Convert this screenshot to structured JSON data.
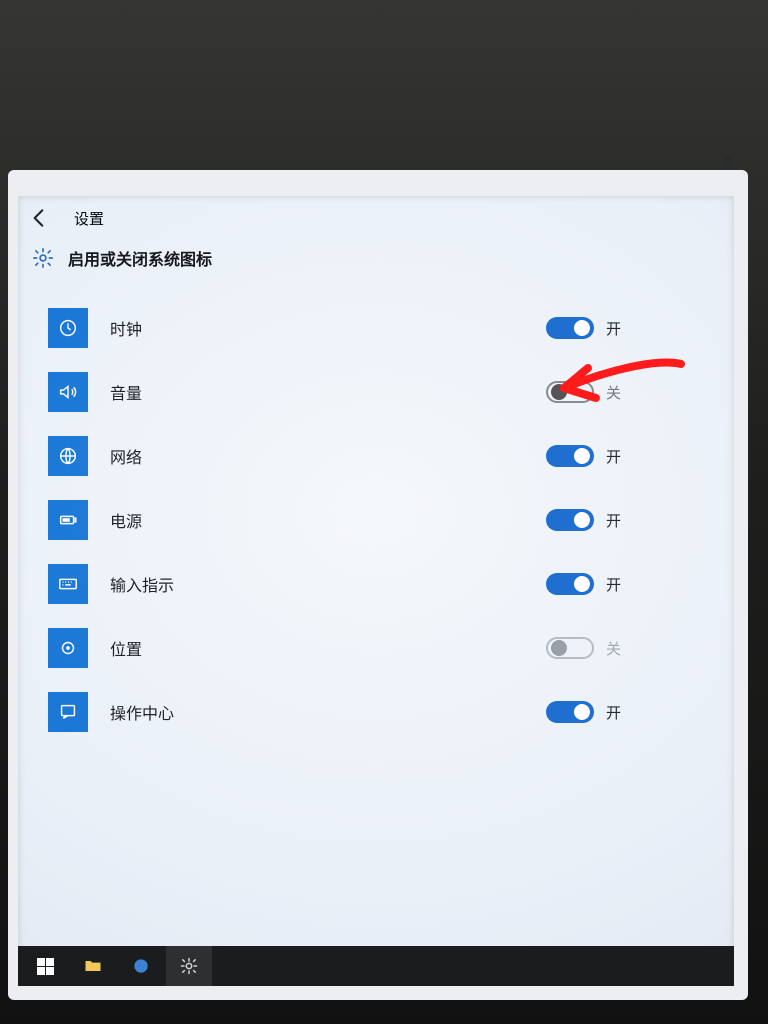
{
  "header": {
    "app_title": "设置",
    "page_title": "启用或关闭系统图标"
  },
  "states": {
    "on": "开",
    "off": "关"
  },
  "items": [
    {
      "icon": "clock",
      "label": "时钟",
      "state": "on",
      "state_text": "开"
    },
    {
      "icon": "volume",
      "label": "音量",
      "state": "off",
      "state_text": "关"
    },
    {
      "icon": "network",
      "label": "网络",
      "state": "on",
      "state_text": "开"
    },
    {
      "icon": "battery",
      "label": "电源",
      "state": "on",
      "state_text": "开"
    },
    {
      "icon": "keyboard",
      "label": "输入指示",
      "state": "on",
      "state_text": "开"
    },
    {
      "icon": "location",
      "label": "位置",
      "state": "disabled",
      "state_text": "关"
    },
    {
      "icon": "action-center",
      "label": "操作中心",
      "state": "on",
      "state_text": "开"
    }
  ],
  "annotation": {
    "type": "hand-drawn-arrow",
    "points_to_index": 1,
    "color": "#ff1b1b"
  },
  "taskbar": {
    "items": [
      {
        "name": "start",
        "active": false
      },
      {
        "name": "file-explorer",
        "active": false
      },
      {
        "name": "edge",
        "active": false
      },
      {
        "name": "settings",
        "active": true
      }
    ]
  }
}
